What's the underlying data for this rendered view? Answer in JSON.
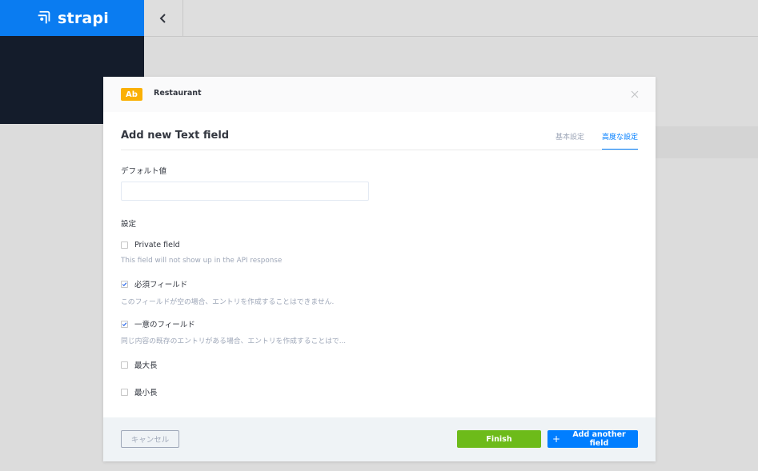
{
  "app": {
    "brand": "strapi"
  },
  "icons": {
    "logo": "strapi-logo-icon",
    "collapse": "chevron-left-icon",
    "close": "close-icon",
    "check": "check-icon",
    "plus": "plus-icon"
  },
  "colors": {
    "brand": "#0a7cf1",
    "sidebar": "#141c2b",
    "accent": "#007eff",
    "finish": "#6dbb1a",
    "badge": "#fab005"
  },
  "modal": {
    "type_badge": "Ab",
    "content_type": "Restaurant",
    "title": "Add new Text field",
    "tabs": [
      {
        "label": "基本設定",
        "active": false
      },
      {
        "label": "高度な設定",
        "active": true
      }
    ],
    "default_value": {
      "label": "デフォルト値",
      "value": "",
      "placeholder": ""
    },
    "settings_label": "設定",
    "settings": [
      {
        "label": "Private field",
        "checked": false,
        "description": "This field will not show up in the API response"
      },
      {
        "label": "必須フィールド",
        "checked": true,
        "description": "このフィールドが空の場合、エントリを作成することはできません."
      },
      {
        "label": "一意のフィールド",
        "checked": true,
        "description": "同じ内容の既存のエントリがある場合、エントリを作成することはで..."
      },
      {
        "label": "最大長",
        "checked": false,
        "description": ""
      },
      {
        "label": "最小長",
        "checked": false,
        "description": ""
      }
    ],
    "footer": {
      "cancel_label": "キャンセル",
      "finish_label": "Finish",
      "add_label": "Add another field"
    }
  }
}
